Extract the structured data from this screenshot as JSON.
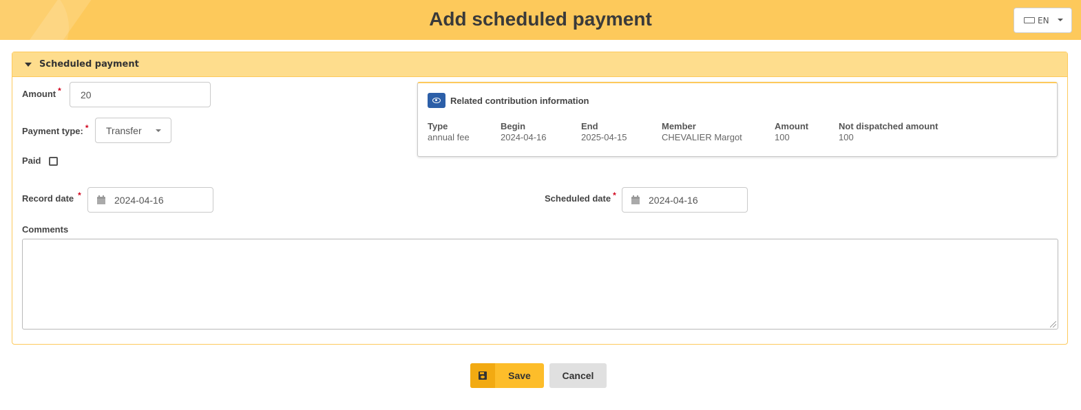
{
  "header": {
    "title": "Add scheduled payment",
    "language": {
      "icon": "translate-icon",
      "label": "EN"
    }
  },
  "panel": {
    "title": "Scheduled payment",
    "accent_color": "#fdc95b"
  },
  "form": {
    "amount": {
      "label": "Amount",
      "required_mark": "*",
      "value": "20"
    },
    "payment_type": {
      "label": "Payment type:",
      "required_mark": "*",
      "value": "Transfer"
    },
    "paid": {
      "label": "Paid",
      "checked": false
    },
    "record_date": {
      "label": "Record date",
      "required_mark": "*",
      "value": "2024-04-16"
    },
    "scheduled_date": {
      "label": "Scheduled date",
      "required_mark": "*",
      "value": "2024-04-16"
    },
    "comments": {
      "label": "Comments",
      "value": ""
    }
  },
  "contribution": {
    "title": "Related contribution information",
    "columns": [
      {
        "header": "Type",
        "value": "annual fee"
      },
      {
        "header": "Begin",
        "value": "2024-04-16"
      },
      {
        "header": "End",
        "value": "2025-04-15"
      },
      {
        "header": "Member",
        "value": "CHEVALIER Margot"
      },
      {
        "header": "Amount",
        "value": "100"
      },
      {
        "header": "Not dispatched amount",
        "value": "100"
      }
    ]
  },
  "actions": {
    "save_label": "Save",
    "cancel_label": "Cancel"
  }
}
